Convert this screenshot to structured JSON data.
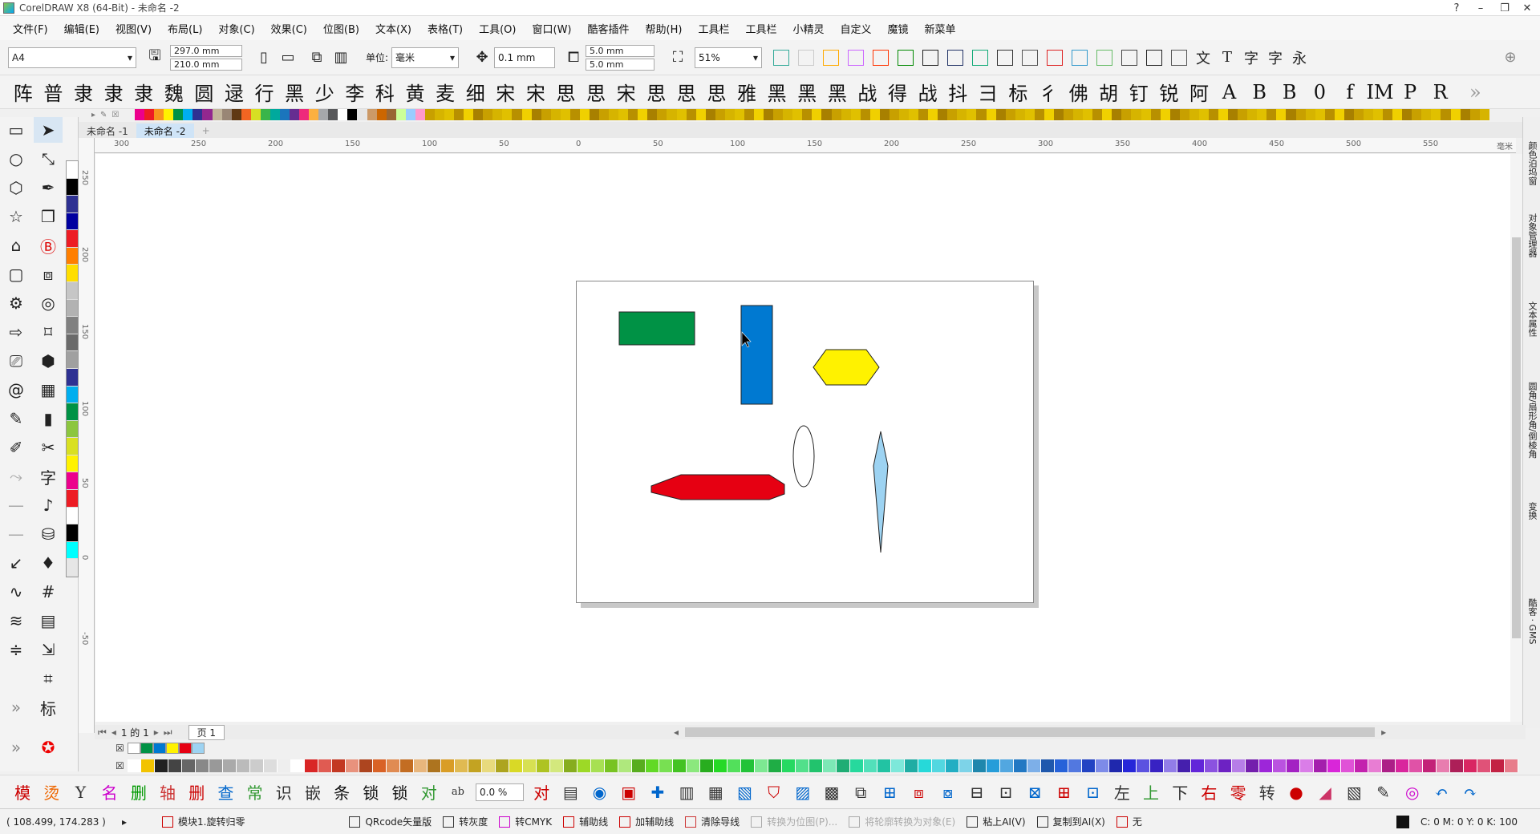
{
  "window": {
    "title": "CorelDRAW X8 (64-Bit) - 未命名 -2"
  },
  "menu": [
    "文件(F)",
    "编辑(E)",
    "视图(V)",
    "布局(L)",
    "对象(C)",
    "效果(C)",
    "位图(B)",
    "文本(X)",
    "表格(T)",
    "工具(O)",
    "窗口(W)",
    "酷客插件",
    "帮助(H)",
    "工具栏",
    "工具栏",
    "小精灵",
    "自定义",
    "魔镜",
    "新菜单"
  ],
  "props": {
    "page_size": "A4",
    "width": "297.0 mm",
    "height": "210.0 mm",
    "unit_label": "单位:",
    "unit_value": "毫米",
    "nudge": "0.1 mm",
    "dup_x": "5.0 mm",
    "dup_y": "5.0 mm",
    "zoom": "51%"
  },
  "toolbar_glyphs": [
    "文",
    "T",
    "字",
    "字",
    "永"
  ],
  "font_glyphs": [
    "阵",
    "普",
    "隶",
    "隶",
    "隶",
    "魏",
    "圆",
    "逯",
    "行",
    "黑",
    "少",
    "李",
    "科",
    "黄",
    "麦",
    "细",
    "宋",
    "宋",
    "思",
    "思",
    "宋",
    "思",
    "思",
    "思",
    "雅",
    "黑",
    "黑",
    "黑",
    "战",
    "得",
    "战",
    "抖",
    "彐",
    "标",
    "彳",
    "佛",
    "胡",
    "钉",
    "锐",
    "阿",
    "A",
    "B",
    "B",
    "0",
    "f",
    "IM",
    "P",
    "R"
  ],
  "doc_tabs": [
    "未命名 -1",
    "未命名 -2"
  ],
  "ruler": {
    "h": [
      "300",
      "250",
      "200",
      "150",
      "100",
      "50",
      "0",
      "50",
      "100",
      "150",
      "200",
      "250",
      "300",
      "350",
      "400",
      "450",
      "500",
      "550"
    ],
    "v": [
      "250",
      "200",
      "150",
      "100",
      "50",
      "0",
      "-50"
    ],
    "unit": "毫米"
  },
  "pagenav": {
    "of": "1 的 1",
    "page_tab": "页 1"
  },
  "right_tabs": [
    "颜色泊坞窗",
    "对象管理器",
    "文本属性",
    "圆角/扇形角/倒棱角",
    "变换",
    "酷客 · GMS"
  ],
  "bottom_glyphs": [
    "模",
    "烫",
    "Y",
    "名",
    "删",
    "轴",
    "删",
    "查",
    "常",
    "识",
    "嵌",
    "条",
    "锁",
    "锁",
    "对",
    "ab",
    "对"
  ],
  "bottom_value": "0.0 %",
  "bottom_glyphs2": [
    "左",
    "上",
    "下",
    "右",
    "零",
    "转"
  ],
  "status": {
    "coords": "( 108.499, 174.283 )",
    "items": [
      "模块1.旋转归零",
      "QRcode矢量版",
      "转灰度",
      "转CMYK",
      "辅助线",
      "加辅助线",
      "清除导线",
      "转换为位图(P)...",
      "将轮廓转换为对象(E)",
      "粘上AI(V)",
      "复制到AI(X)",
      "无"
    ],
    "color": "C: 0 M: 0 Y: 0 K: 100"
  },
  "shapes": {
    "green_rect": "#009245",
    "blue_rect": "#0079d1",
    "yellow_hex": "#fff200",
    "red_hex": "#e60012",
    "ellipse": "#ffffff",
    "diamond": "#9dd3f2"
  },
  "palette_colors": [
    "#ffffff",
    "#000000",
    "#2e3192",
    "#0000a0",
    "#ed1c24",
    "#ff7f00",
    "#ffde00",
    "#c6c6c6",
    "#b2b2b2",
    "#808080",
    "#6a6a6a",
    "#a0a0a0",
    "#2e3192",
    "#00aeef",
    "#009245",
    "#8cc63f",
    "#d9e021",
    "#fff200",
    "#ec008c",
    "#ed1c24",
    "#ffffff",
    "#000000",
    "#00ffff",
    "#e6e6e6"
  ],
  "strip_colors": [
    "#ec008c",
    "#ed1c24",
    "#f7941d",
    "#fff200",
    "#009245",
    "#00aeef",
    "#2e3192",
    "#92278f",
    "#c2b59b",
    "#998675",
    "#603913",
    "#f26522",
    "#d7df23",
    "#39b54a",
    "#00a99d",
    "#1b75bc",
    "#662d91",
    "#ee2a7b",
    "#fbb040",
    "#a6a8ab",
    "#58595b",
    "#ffffff",
    "#000000",
    "#e6e6e6",
    "#cc9966",
    "#cc6600",
    "#996633",
    "#ccff99",
    "#99ccff",
    "#ff99cc"
  ]
}
